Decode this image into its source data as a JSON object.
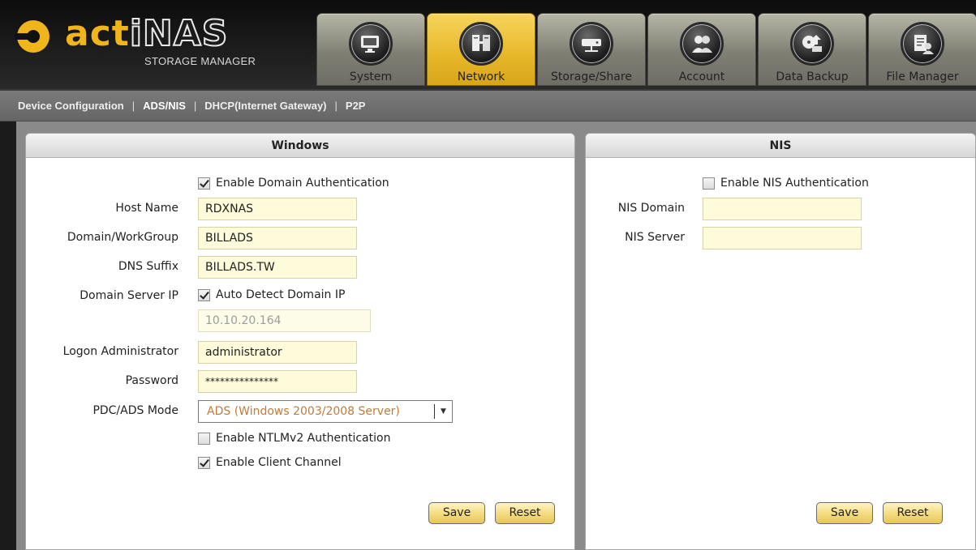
{
  "brand": {
    "logo_part1": "act",
    "logo_part2": "iNAS",
    "subtitle": "STORAGE MANAGER"
  },
  "nav": {
    "tabs": [
      {
        "label": "System",
        "icon": "monitor-icon"
      },
      {
        "label": "Network",
        "icon": "network-icon"
      },
      {
        "label": "Storage/Share",
        "icon": "storage-icon"
      },
      {
        "label": "Account",
        "icon": "users-icon"
      },
      {
        "label": "Data Backup",
        "icon": "backup-icon"
      },
      {
        "label": "File Manager",
        "icon": "file-manager-icon"
      }
    ],
    "active": "Network"
  },
  "subnav": {
    "items": [
      "Device Configuration",
      "ADS/NIS",
      "DHCP(Internet Gateway)",
      "P2P"
    ],
    "active": "ADS/NIS"
  },
  "windows_panel": {
    "title": "Windows",
    "enable_domain_auth": {
      "label": "Enable Domain Authentication",
      "checked": true
    },
    "host_name": {
      "label": "Host Name",
      "value": "RDXNAS"
    },
    "domain_workgroup": {
      "label": "Domain/WorkGroup",
      "value": "BILLADS"
    },
    "dns_suffix": {
      "label": "DNS Suffix",
      "value": "BILLADS.TW"
    },
    "domain_server_ip": {
      "label": "Domain Server IP",
      "auto_detect_label": "Auto Detect Domain IP",
      "auto_detect_checked": true,
      "value": "10.10.20.164"
    },
    "logon_admin": {
      "label": "Logon Administrator",
      "value": "administrator"
    },
    "password": {
      "label": "Password",
      "value": "***************"
    },
    "pdc_ads_mode": {
      "label": "PDC/ADS Mode",
      "value": "ADS (Windows 2003/2008 Server)"
    },
    "enable_ntlmv2": {
      "label": "Enable NTLMv2 Authentication",
      "checked": false
    },
    "enable_client_channel": {
      "label": "Enable Client Channel",
      "checked": true
    },
    "save_label": "Save",
    "reset_label": "Reset"
  },
  "nis_panel": {
    "title": "NIS",
    "enable_nis_auth": {
      "label": "Enable NIS Authentication",
      "checked": false
    },
    "nis_domain": {
      "label": "NIS Domain",
      "value": ""
    },
    "nis_server": {
      "label": "NIS Server",
      "value": ""
    },
    "save_label": "Save",
    "reset_label": "Reset"
  },
  "colors": {
    "accent": "#e8b92c",
    "field_bg": "#fdfbd9",
    "select_text": "#c07a3a"
  }
}
